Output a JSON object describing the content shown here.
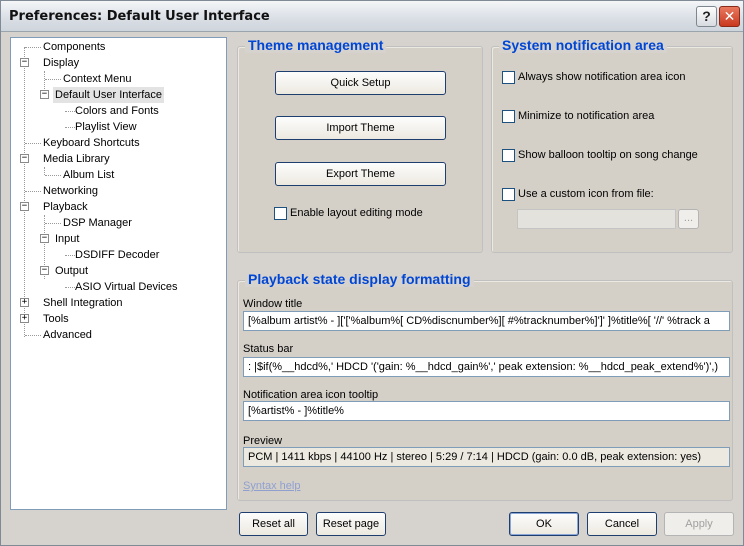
{
  "window": {
    "title": "Preferences: Default User Interface",
    "help_glyph": "?",
    "close_glyph": "✕"
  },
  "tree": {
    "items": [
      {
        "label": "Components",
        "expander": ""
      },
      {
        "label": "Display",
        "expander": "−"
      },
      {
        "label": "Context Menu",
        "expander": ""
      },
      {
        "label": "Default User Interface",
        "expander": "−",
        "selected": true
      },
      {
        "label": "Colors and Fonts",
        "expander": ""
      },
      {
        "label": "Playlist View",
        "expander": ""
      },
      {
        "label": "Keyboard Shortcuts",
        "expander": ""
      },
      {
        "label": "Media Library",
        "expander": "−"
      },
      {
        "label": "Album List",
        "expander": ""
      },
      {
        "label": "Networking",
        "expander": ""
      },
      {
        "label": "Playback",
        "expander": "−"
      },
      {
        "label": "DSP Manager",
        "expander": ""
      },
      {
        "label": "Input",
        "expander": "−"
      },
      {
        "label": "DSDIFF Decoder",
        "expander": ""
      },
      {
        "label": "Output",
        "expander": "−"
      },
      {
        "label": "ASIO Virtual Devices",
        "expander": ""
      },
      {
        "label": "Shell Integration",
        "expander": "+"
      },
      {
        "label": "Tools",
        "expander": "+"
      },
      {
        "label": "Advanced",
        "expander": ""
      }
    ]
  },
  "theme": {
    "title": "Theme management",
    "quick_setup": "Quick Setup",
    "import_theme": "Import Theme",
    "export_theme": "Export Theme",
    "layout_editing": "Enable layout editing mode"
  },
  "notification": {
    "title": "System notification area",
    "always_show": "Always show notification area icon",
    "minimize": "Minimize to notification area",
    "balloon": "Show balloon tooltip on song change",
    "custom_icon": "Use a custom icon from file:",
    "custom_icon_path": "",
    "browse": "..."
  },
  "playback_format": {
    "title": "Playback state display formatting",
    "window_title_label": "Window title",
    "window_title_value": "[%album artist% - ]['['%album%[ CD%discnumber%][ #%tracknumber%]']' ]%title%[ '//' %track a",
    "status_bar_label": "Status bar",
    "status_bar_value": ": |$if(%__hdcd%,' HDCD '('gain: %__hdcd_gain%',' peak extension: %__hdcd_peak_extend%')',)",
    "tooltip_label": "Notification area icon tooltip",
    "tooltip_value": "[%artist% - ]%title%",
    "preview_label": "Preview",
    "preview_value": "PCM | 1411 kbps | 44100 Hz | stereo | 5:29 / 7:14  | HDCD (gain: 0.0 dB, peak extension: yes)",
    "syntax_help": "Syntax help"
  },
  "footer": {
    "reset_all": "Reset all",
    "reset_page": "Reset page",
    "ok": "OK",
    "cancel": "Cancel",
    "apply": "Apply"
  }
}
